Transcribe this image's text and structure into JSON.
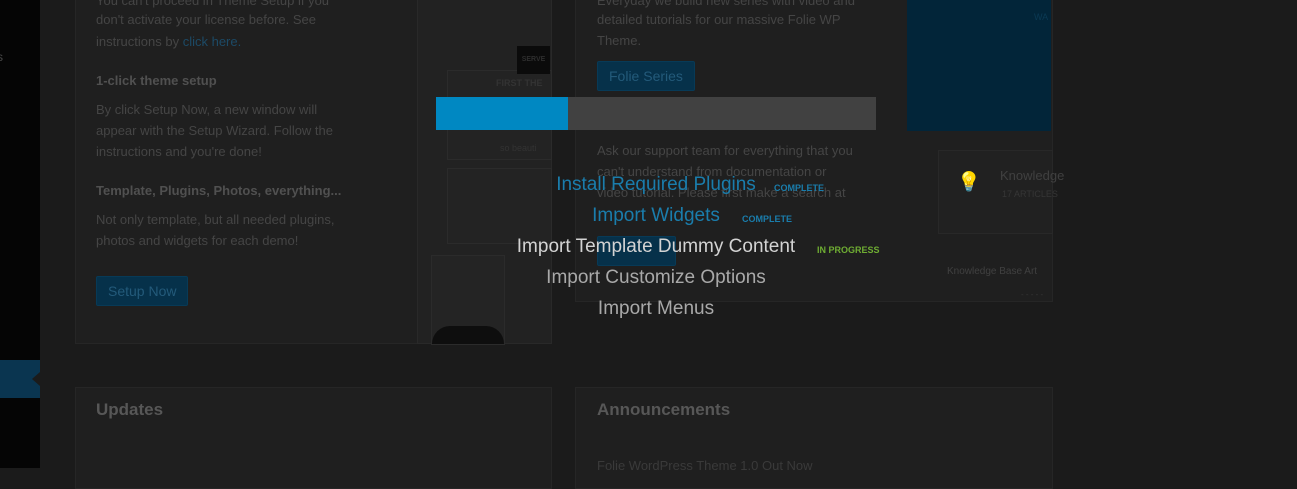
{
  "sidebar": {
    "partial_text": "s"
  },
  "license_panel": {
    "intro_line1": "You can't proceed in Theme Setup if you",
    "intro_line2": "don't activate your license before. See",
    "intro_line3_prefix": "instructions by ",
    "intro_link": "click here.",
    "setup_heading": "1-click theme setup",
    "setup_desc1": "By click Setup Now, a new window will",
    "setup_desc2": "appear with the Setup Wizard. Follow the",
    "setup_desc3": "instructions and you're done!",
    "template_heading": "Template, Plugins, Photos, everything...",
    "template_desc1": "Not only template, but all needed plugins,",
    "template_desc2": "photos and widgets for each demo!",
    "setup_button": "Setup Now"
  },
  "thumbnail": {
    "badge": "SERVE",
    "caption": "FIRST THE",
    "link": "so beauti"
  },
  "tutorials_panel": {
    "text1": "Everyday we build new series with video and",
    "text2": "detailed tutorials for our massive Folie WP",
    "text3": "Theme.",
    "series_button": "Folie Series",
    "support1": "Ask our support team for everything that you",
    "support2": "can't understand from documentation or",
    "support3": "video tutorial. Please first make a search at"
  },
  "promo": {
    "text": "WA"
  },
  "knowledge": {
    "title": "Knowledge",
    "subtitle": "17 ARTICLES",
    "footer": "Knowledge Base Art",
    "footer2": "- - - - -"
  },
  "updates": {
    "heading": "Updates"
  },
  "announcements": {
    "heading": "Announcements",
    "first_item": "Folie WordPress Theme 1.0 Out Now"
  },
  "progress": {
    "percent": 30
  },
  "steps": [
    {
      "label": "Install Required Plugins",
      "status": "COMPLETE"
    },
    {
      "label": "Import Widgets",
      "status": "COMPLETE"
    },
    {
      "label": "Import Template Dummy Content",
      "status": "IN PROGRESS"
    },
    {
      "label": "Import Customize Options",
      "status": ""
    },
    {
      "label": "Import Menus",
      "status": ""
    }
  ],
  "colors": {
    "accent": "#0088c2",
    "complete": "#1a7dac",
    "in_progress": "#6fad33"
  }
}
